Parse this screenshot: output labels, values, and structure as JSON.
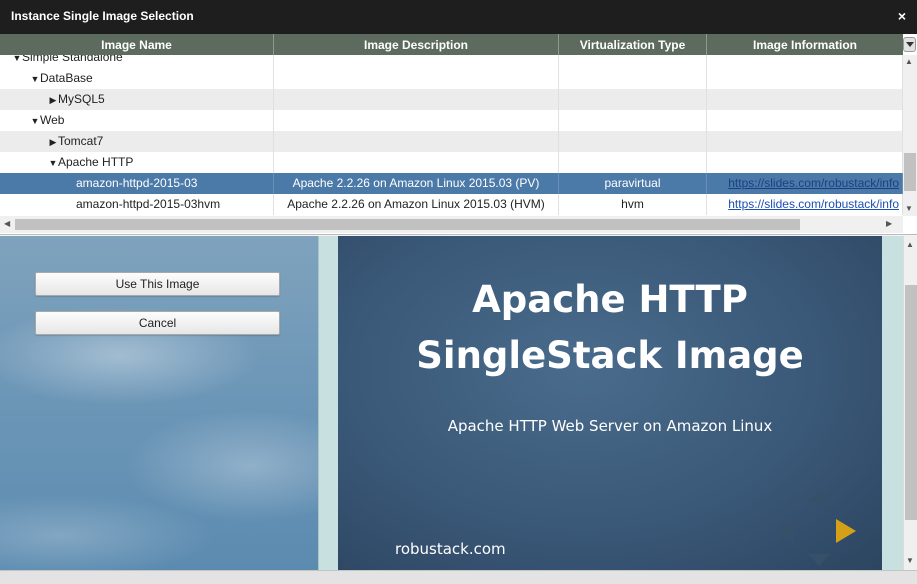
{
  "window": {
    "title": "Instance Single Image Selection",
    "close_glyph": "×"
  },
  "grid": {
    "columns": [
      "Image Name",
      "Image Description",
      "Virtualization Type",
      "Image Information"
    ],
    "rows": [
      {
        "indent": 0,
        "toggle": "▼",
        "name": "Simple Standalone",
        "description": "",
        "virtualization": "",
        "info": ""
      },
      {
        "indent": 1,
        "toggle": "▼",
        "name": "DataBase",
        "description": "",
        "virtualization": "",
        "info": ""
      },
      {
        "indent": 2,
        "toggle": "▶",
        "name": "MySQL5",
        "description": "",
        "virtualization": "",
        "info": ""
      },
      {
        "indent": 1,
        "toggle": "▼",
        "name": "Web",
        "description": "",
        "virtualization": "",
        "info": ""
      },
      {
        "indent": 2,
        "toggle": "▶",
        "name": "Tomcat7",
        "description": "",
        "virtualization": "",
        "info": ""
      },
      {
        "indent": 2,
        "toggle": "▼",
        "name": "Apache HTTP",
        "description": "",
        "virtualization": "",
        "info": ""
      },
      {
        "indent": 3,
        "toggle": "",
        "name": "amazon-httpd-2015-03",
        "description": "Apache 2.2.26 on Amazon Linux 2015.03 (PV)",
        "virtualization": "paravirtual",
        "info": "https://slides.com/robustack/info",
        "selected": true
      },
      {
        "indent": 3,
        "toggle": "",
        "name": "amazon-httpd-2015-03hvm",
        "description": "Apache 2.2.26 on Amazon Linux 2015.03 (HVM)",
        "virtualization": "hvm",
        "info": "https://slides.com/robustack/info"
      }
    ]
  },
  "actions": {
    "use_image": "Use This Image",
    "cancel": "Cancel"
  },
  "preview": {
    "heading_line1": "Apache HTTP",
    "heading_line2": "SingleStack Image",
    "subtitle": "Apache HTTP Web Server on Amazon Linux",
    "brand": "robustack.com"
  },
  "colors": {
    "title_bar": "#1e1e1e",
    "header": "#5d6b5e",
    "selected_row": "#4c7aa8",
    "slide_bg": "#3a5878",
    "nav_active": "#d4a017"
  },
  "icons": {
    "column_menu": "chevron-down-icon",
    "nav_up": "arrow-up-icon",
    "nav_down": "arrow-down-icon",
    "nav_left": "arrow-left-icon",
    "nav_right": "arrow-right-icon"
  }
}
